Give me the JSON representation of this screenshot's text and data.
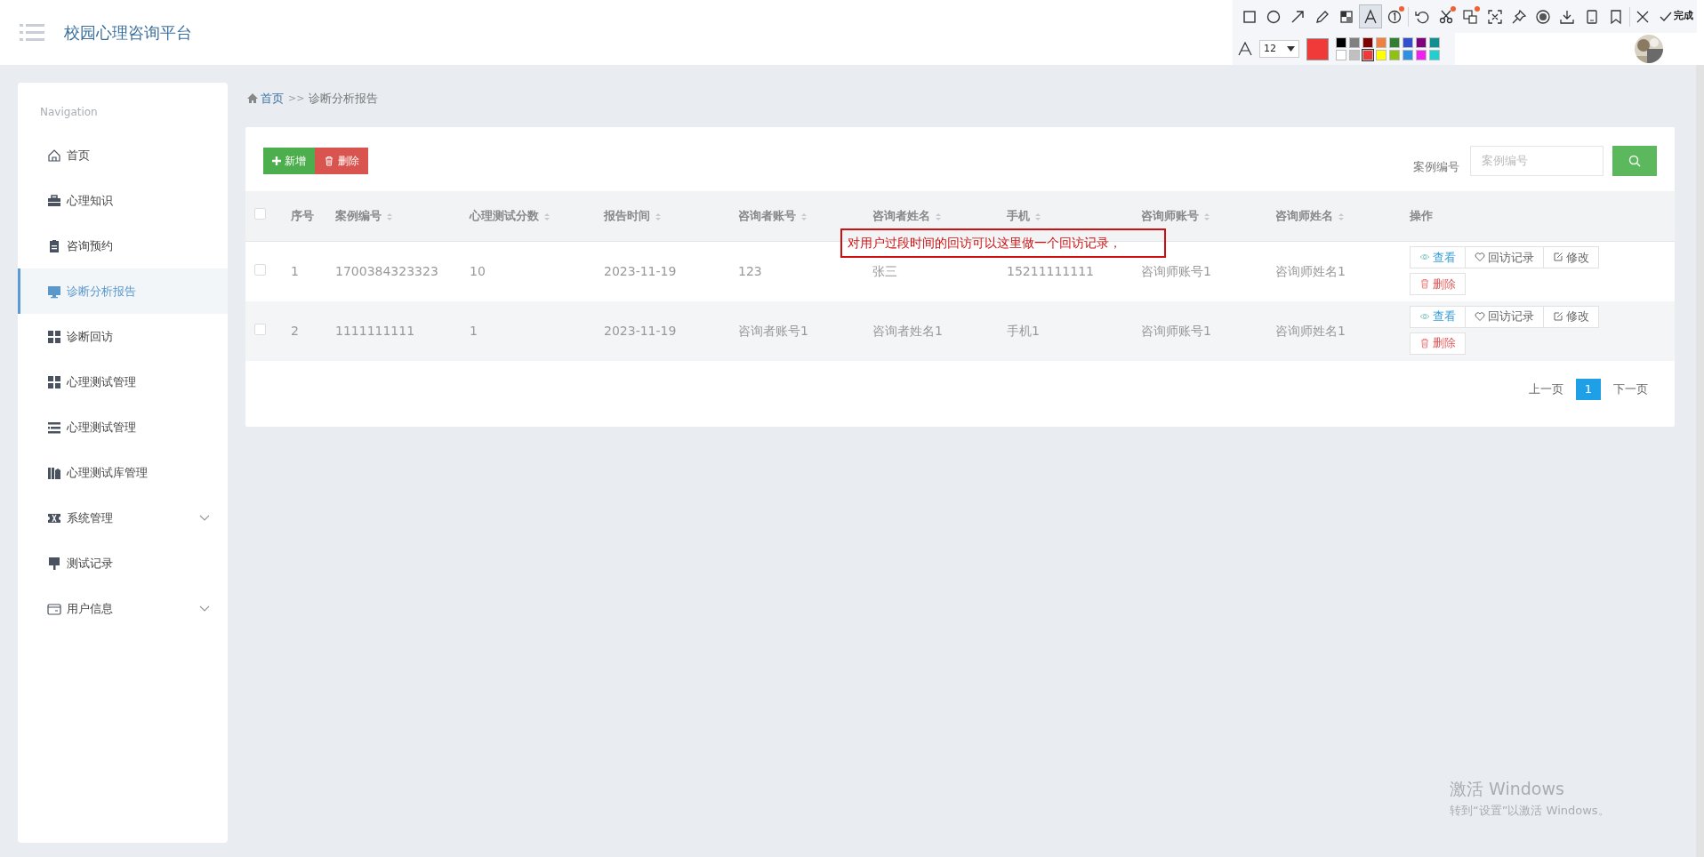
{
  "header": {
    "title": "校园心理咨询平台"
  },
  "sidebar": {
    "heading": "Navigation",
    "items": [
      {
        "label": "首页",
        "selected": false,
        "expandable": false
      },
      {
        "label": "心理知识",
        "selected": false,
        "expandable": false
      },
      {
        "label": "咨询预约",
        "selected": false,
        "expandable": false
      },
      {
        "label": "诊断分析报告",
        "selected": true,
        "expandable": false
      },
      {
        "label": "诊断回访",
        "selected": false,
        "expandable": false
      },
      {
        "label": "心理测试管理",
        "selected": false,
        "expandable": false
      },
      {
        "label": "心理测试管理",
        "selected": false,
        "expandable": false
      },
      {
        "label": "心理测试库管理",
        "selected": false,
        "expandable": false
      },
      {
        "label": "系统管理",
        "selected": false,
        "expandable": true
      },
      {
        "label": "测试记录",
        "selected": false,
        "expandable": false
      },
      {
        "label": "用户信息",
        "selected": false,
        "expandable": true
      }
    ]
  },
  "breadcrumb": {
    "home": "首页",
    "separator": ">>",
    "current": "诊断分析报告"
  },
  "toolbar": {
    "add_label": "新增",
    "delete_label": "删除",
    "search_label": "案例编号",
    "search_placeholder": "案例编号"
  },
  "table": {
    "select_all_checked": false,
    "columns": [
      {
        "label": "序号",
        "sortable": false
      },
      {
        "label": "案例编号",
        "sortable": true
      },
      {
        "label": "心理测试分数",
        "sortable": true
      },
      {
        "label": "报告时间",
        "sortable": true
      },
      {
        "label": "咨询者账号",
        "sortable": true
      },
      {
        "label": "咨询者姓名",
        "sortable": true
      },
      {
        "label": "手机",
        "sortable": true
      },
      {
        "label": "咨询师账号",
        "sortable": true
      },
      {
        "label": "咨询师姓名",
        "sortable": true
      },
      {
        "label": "操作",
        "sortable": false
      }
    ],
    "rows": [
      {
        "checked": false,
        "cells": [
          "1",
          "1700384323323",
          "10",
          "2023-11-19",
          "123",
          "张三",
          "15211111111",
          "咨询师账号1",
          "咨询师姓名1"
        ],
        "actions": [
          {
            "kind": "view",
            "label": "查看"
          },
          {
            "kind": "followup",
            "label": "回访记录"
          },
          {
            "kind": "edit",
            "label": "修改"
          },
          {
            "kind": "delete",
            "label": "删除"
          }
        ]
      },
      {
        "checked": false,
        "cells": [
          "2",
          "1111111111",
          "1",
          "2023-11-19",
          "咨询者账号1",
          "咨询者姓名1",
          "手机1",
          "咨询师账号1",
          "咨询师姓名1"
        ],
        "actions": [
          {
            "kind": "view",
            "label": "查看"
          },
          {
            "kind": "followup",
            "label": "回访记录"
          },
          {
            "kind": "edit",
            "label": "修改"
          },
          {
            "kind": "delete",
            "label": "删除"
          }
        ]
      }
    ]
  },
  "pagination": {
    "prev": "上一页",
    "pages": [
      {
        "label": "1",
        "selected": true
      }
    ],
    "next": "下一页"
  },
  "annotation": {
    "text": "对用户过段时间的回访可以这里做一个回访记录，"
  },
  "screenshot_tool": {
    "tools": [
      {
        "kind": "rectangle",
        "selected": false,
        "badge": false
      },
      {
        "kind": "ellipse",
        "selected": false,
        "badge": false
      },
      {
        "kind": "arrow",
        "selected": false,
        "badge": false
      },
      {
        "kind": "pencil",
        "selected": false,
        "badge": false
      },
      {
        "kind": "mosaic",
        "selected": false,
        "badge": false
      },
      {
        "kind": "text",
        "selected": true,
        "badge": false
      },
      {
        "kind": "number",
        "selected": false,
        "badge": true
      },
      {
        "kind": "divider"
      },
      {
        "kind": "undo",
        "selected": false,
        "badge": false
      },
      {
        "kind": "cut",
        "selected": false,
        "badge": true
      },
      {
        "kind": "translate",
        "selected": false,
        "badge": true
      },
      {
        "kind": "ocr",
        "selected": false,
        "badge": false
      },
      {
        "kind": "pin",
        "selected": false,
        "badge": false
      },
      {
        "kind": "record",
        "selected": false,
        "badge": false
      },
      {
        "kind": "download",
        "selected": false,
        "badge": false
      },
      {
        "kind": "phone",
        "selected": false,
        "badge": false
      },
      {
        "kind": "bookmark",
        "selected": false,
        "badge": false
      },
      {
        "kind": "divider"
      },
      {
        "kind": "close",
        "selected": false,
        "badge": false
      }
    ],
    "done_label": "完成",
    "font_size": "12",
    "palette": [
      {
        "color": "#000000",
        "selected": false
      },
      {
        "color": "#808080",
        "selected": false
      },
      {
        "color": "#800000",
        "selected": false
      },
      {
        "color": "#f08040",
        "selected": false
      },
      {
        "color": "#308030",
        "selected": false
      },
      {
        "color": "#3050d0",
        "selected": false
      },
      {
        "color": "#800080",
        "selected": false
      },
      {
        "color": "#109090",
        "selected": false
      },
      {
        "color": "#ffffff",
        "selected": false
      },
      {
        "color": "#c0c0c0",
        "selected": false
      },
      {
        "color": "#f03a3a",
        "selected": true
      },
      {
        "color": "#ffff00",
        "selected": false
      },
      {
        "color": "#90c010",
        "selected": false
      },
      {
        "color": "#3090e0",
        "selected": false
      },
      {
        "color": "#f020f0",
        "selected": false
      },
      {
        "color": "#20d0d0",
        "selected": false
      }
    ]
  },
  "os_notice": {
    "title": "激活 Windows",
    "text": "转到“设置”以激活 Windows。"
  }
}
